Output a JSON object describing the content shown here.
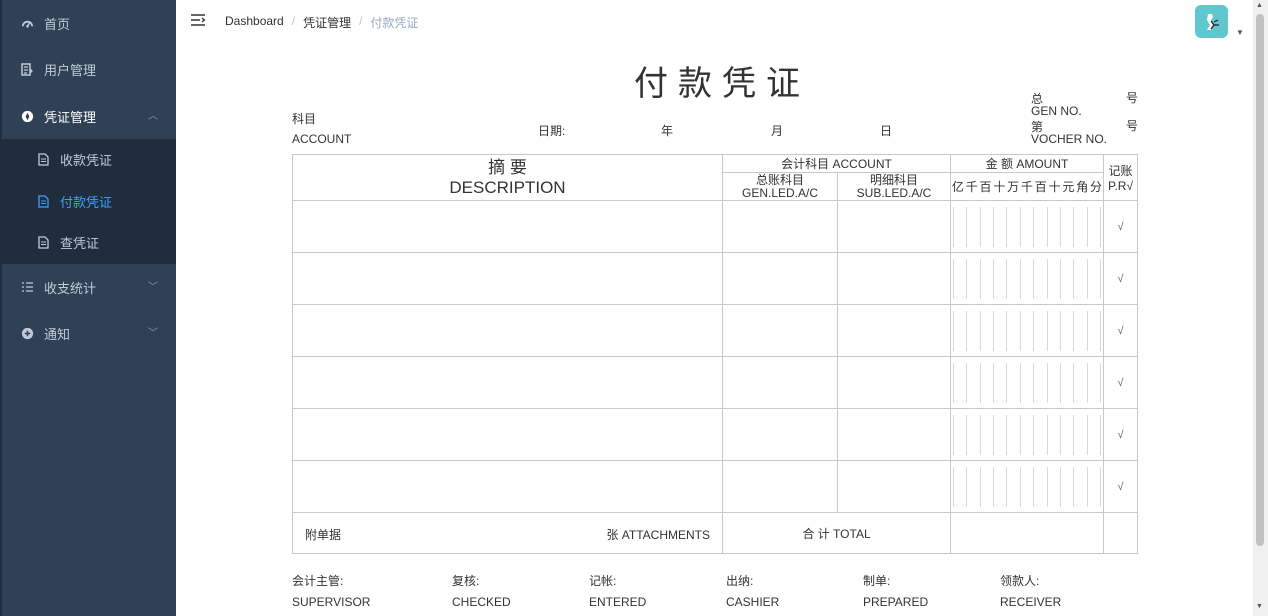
{
  "sidebar": {
    "items": [
      {
        "label": "首页"
      },
      {
        "label": "用户管理"
      },
      {
        "label": "凭证管理"
      },
      {
        "label": "收支统计"
      },
      {
        "label": "通知"
      }
    ],
    "sub_items": [
      {
        "label": "收款凭证"
      },
      {
        "label": "付款凭证"
      },
      {
        "label": "查凭证"
      }
    ],
    "colors": {
      "bg": "#304156",
      "submenu_bg": "#1f2d3d",
      "active": "#409eff"
    }
  },
  "breadcrumb": {
    "items": [
      "Dashboard",
      "凭证管理",
      "付款凭证"
    ],
    "separator": "/"
  },
  "voucher": {
    "title": "付款凭证",
    "account_cn": "科目",
    "account_en": "ACCOUNT",
    "date_label": "日期:",
    "year": "年",
    "month": "月",
    "day": "日",
    "gen_cn": "总",
    "gen_hao": "号",
    "gen_en": "GEN NO.",
    "voc_cn": "第",
    "voc_hao": "号",
    "voc_en": "VOCHER NO.",
    "desc_cn": "摘 要",
    "desc_en": "DESCRIPTION",
    "acct_header": "会计科目 ACCOUNT",
    "gen_led_cn": "总账科目",
    "gen_led_en": "GEN.LED.A/C",
    "sub_led_cn": "明细科目",
    "sub_led_en": "SUB.LED.A/C",
    "amount_header": "金 额 AMOUNT",
    "amount_digits": [
      "亿",
      "千",
      "百",
      "十",
      "万",
      "千",
      "百",
      "十",
      "元",
      "角",
      "分"
    ],
    "pr_cn": "记账",
    "pr_en": "P.R√",
    "check_mark": "√",
    "row_count": 6,
    "attach_cn": "附单据",
    "attach_en": "张 ATTACHMENTS",
    "total": "合 计 TOTAL"
  },
  "footer": [
    {
      "cn": "会计主管:",
      "en": "SUPERVISOR"
    },
    {
      "cn": "复核:",
      "en": "CHECKED"
    },
    {
      "cn": "记帐:",
      "en": "ENTERED"
    },
    {
      "cn": "出纳:",
      "en": "CASHIER"
    },
    {
      "cn": "制单:",
      "en": "PREPARED"
    },
    {
      "cn": "领款人:",
      "en": "RECEIVER"
    }
  ]
}
